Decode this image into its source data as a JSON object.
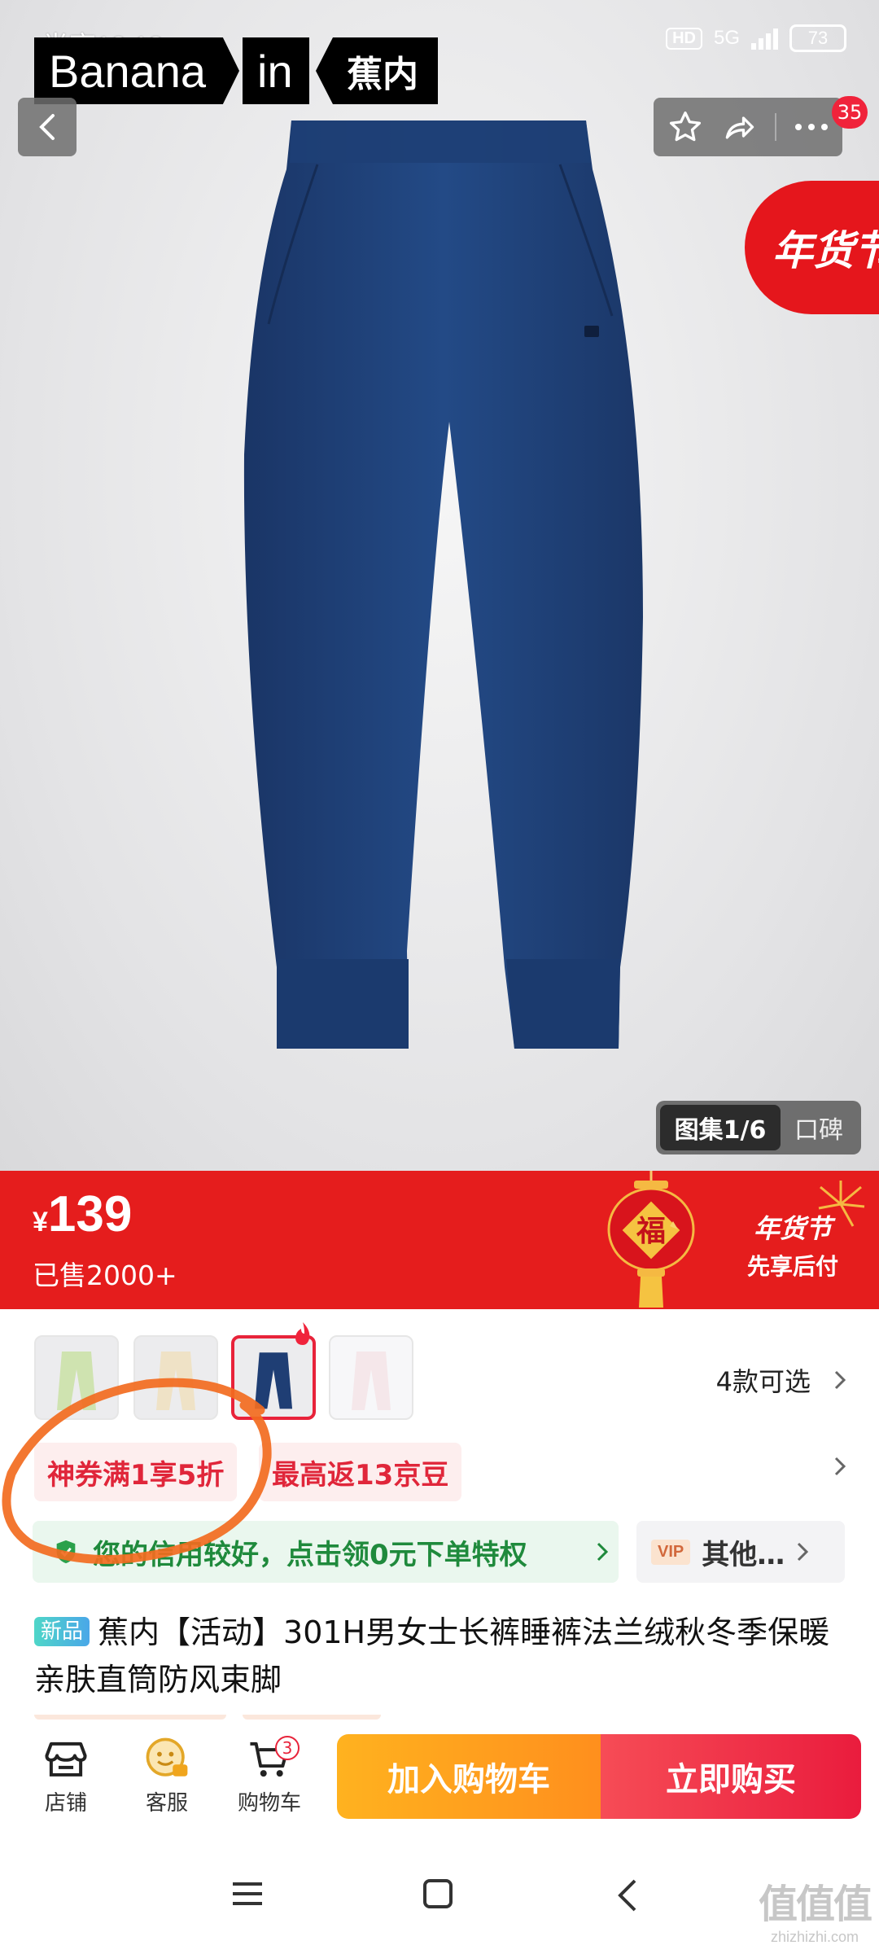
{
  "status_bar": {
    "time": "半夜12:13",
    "hd": "HD",
    "network": "5G",
    "battery": "73"
  },
  "brand": {
    "part1": "Banana",
    "part2": "in",
    "part3": "蕉内"
  },
  "top_actions": {
    "notification_count": "35"
  },
  "festival_tag": "年货节",
  "gallery": {
    "active_tab": "图集1/6",
    "other_tab": "口碑"
  },
  "price": {
    "currency": "¥",
    "amount": "139",
    "sold": "已售2000+"
  },
  "festival_banner": {
    "lantern_char": "福",
    "title": "年货节",
    "subtitle": "先享后付"
  },
  "sku": {
    "variants_label": "4款可选",
    "variant_count": 4,
    "selected_index": 2
  },
  "coupons": [
    "神券满1享5折",
    "最高返13京豆"
  ],
  "credit": {
    "text": "您的信用较好，点击领0元下单特权",
    "vip_badge": "VIP",
    "vip_text": "其他…"
  },
  "product": {
    "tag": "新品",
    "title": "蕉内【活动】301H男女士长裤睡裤法兰绒秋冬季保暖亲肤直筒防风束脚"
  },
  "bottom_nav": {
    "shop": "店铺",
    "service": "客服",
    "cart": "购物车",
    "cart_count": "3"
  },
  "cta": {
    "add_to_cart": "加入购物车",
    "buy_now": "立即购买"
  },
  "watermark": {
    "logo": "值值值",
    "url": "zhizhizhi.com"
  },
  "colors": {
    "brand_red": "#e51d1d",
    "cta_orange": "#ff9f1d",
    "cta_red": "#ea1c3d",
    "credit_green": "#1f8a3c",
    "pants_navy": "#1d3c73"
  }
}
